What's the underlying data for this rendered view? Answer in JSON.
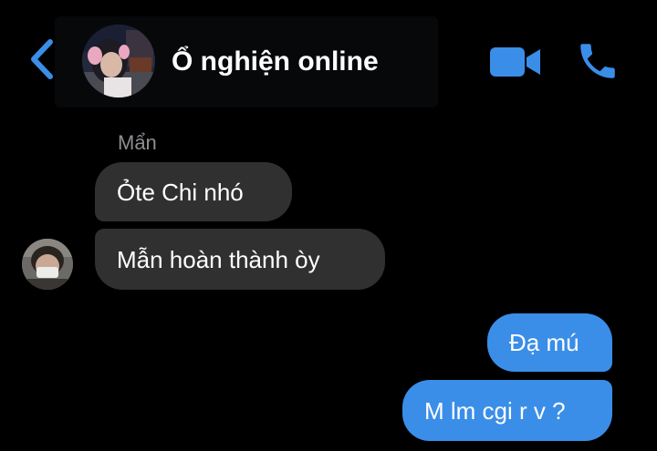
{
  "header": {
    "title": "Ổ nghiện online",
    "back_icon": "chevron-left-icon",
    "video_icon": "video-camera-icon",
    "call_icon": "phone-icon",
    "accent_color": "#3a8ee8"
  },
  "messages": [
    {
      "direction": "incoming",
      "sender": "Mẩn",
      "text": "Ỏte Chi nhó"
    },
    {
      "direction": "incoming",
      "text": "Mẫn hoàn thành òy"
    },
    {
      "direction": "outgoing",
      "text": "Đạ mú"
    },
    {
      "direction": "outgoing",
      "text": "M lm cgi r v ?"
    }
  ],
  "colors": {
    "background": "#000000",
    "incoming_bubble": "#303030",
    "outgoing_bubble": "#3a8ee8",
    "sender_name": "#8e8e93"
  }
}
